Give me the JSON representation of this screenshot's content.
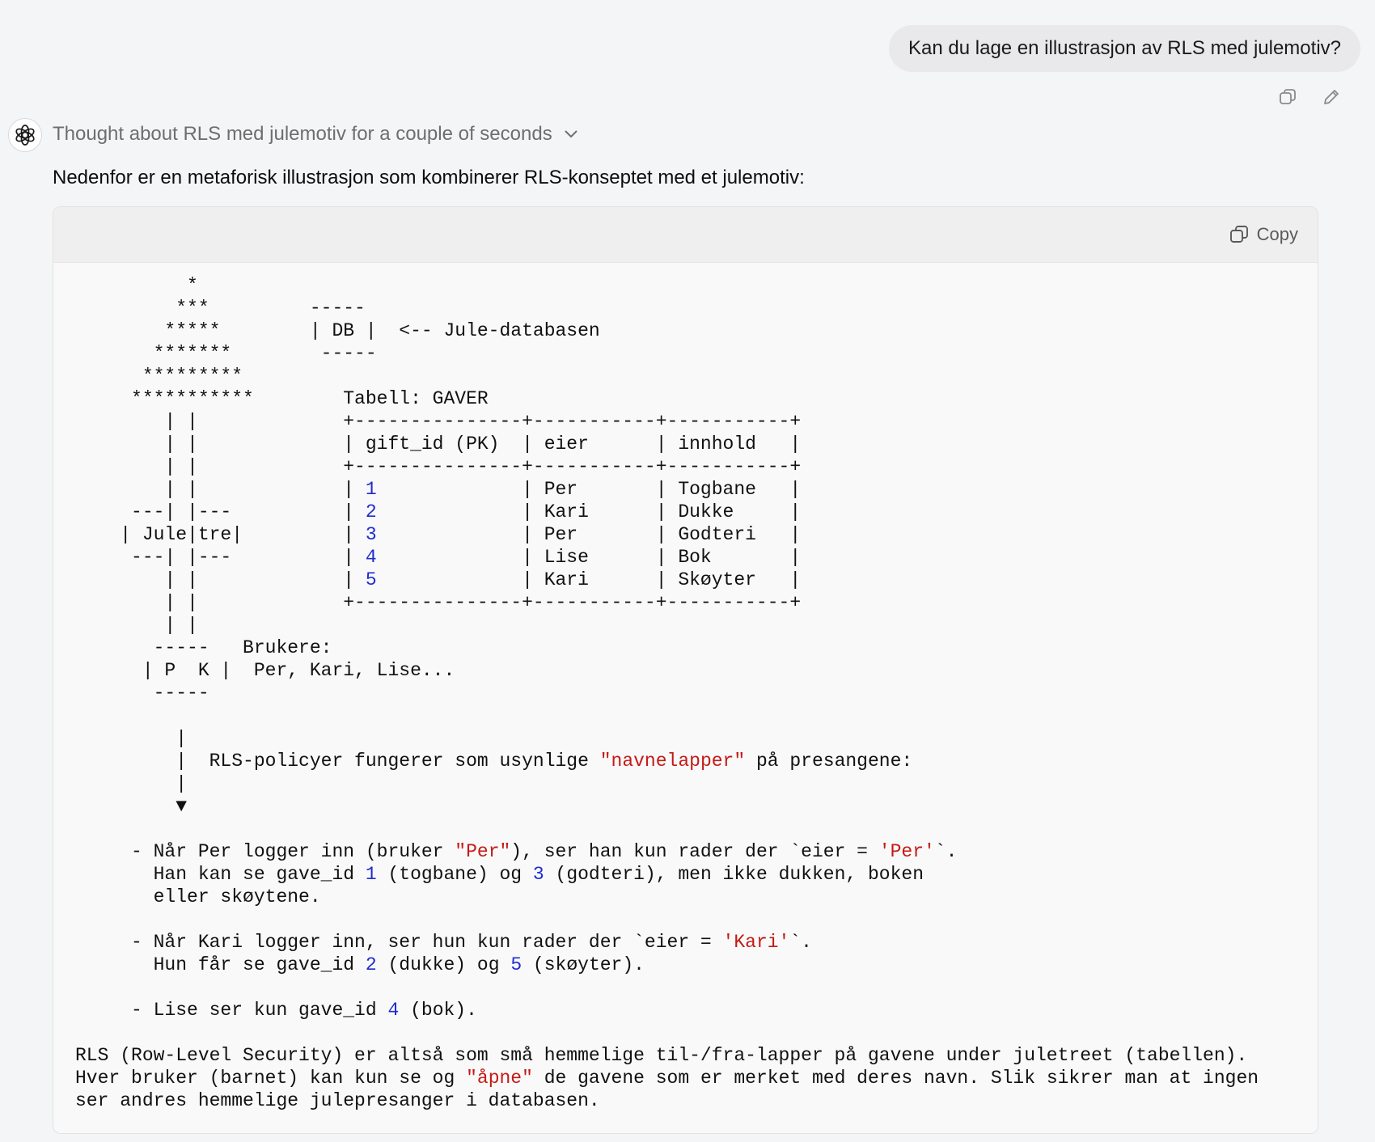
{
  "user_message": "Kan du lage en illustrasjon av RLS med julemotiv?",
  "user_actions": {
    "copy": "copy-icon",
    "edit": "pencil-icon"
  },
  "assistant": {
    "avatar": "openai-logo",
    "thought": "Thought about RLS med julemotiv for a couple of seconds",
    "intro": "Nedenfor er en metaforisk illustrasjon som kombinerer RLS-konseptet med et julemotiv:"
  },
  "code_block": {
    "copy_label": "Copy",
    "lines": [
      [
        {
          "t": "          *"
        }
      ],
      [
        {
          "t": "         ***         -----"
        }
      ],
      [
        {
          "t": "        *****        | DB |  <-- Jule-databasen"
        }
      ],
      [
        {
          "t": "       *******        -----"
        }
      ],
      [
        {
          "t": "      *********"
        }
      ],
      [
        {
          "t": "     ***********        Tabell: GAVER"
        }
      ],
      [
        {
          "t": "        | |             +---------------+-----------+-----------+"
        }
      ],
      [
        {
          "t": "        | |             | gift_id (PK)  | eier      | innhold   |"
        }
      ],
      [
        {
          "t": "        | |             +---------------+-----------+-----------+"
        }
      ],
      [
        {
          "t": "        | |             | "
        },
        {
          "t": "1",
          "c": "num"
        },
        {
          "t": "             | Per       | Togbane   |"
        }
      ],
      [
        {
          "t": "     ---| |---          | "
        },
        {
          "t": "2",
          "c": "num"
        },
        {
          "t": "             | Kari      | Dukke     |"
        }
      ],
      [
        {
          "t": "    | Jule|tre|         | "
        },
        {
          "t": "3",
          "c": "num"
        },
        {
          "t": "             | Per       | Godteri   |"
        }
      ],
      [
        {
          "t": "     ---| |---          | "
        },
        {
          "t": "4",
          "c": "num"
        },
        {
          "t": "             | Lise      | Bok       |"
        }
      ],
      [
        {
          "t": "        | |             | "
        },
        {
          "t": "5",
          "c": "num"
        },
        {
          "t": "             | Kari      | Skøyter   |"
        }
      ],
      [
        {
          "t": "        | |             +---------------+-----------+-----------+"
        }
      ],
      [
        {
          "t": "        | |"
        }
      ],
      [
        {
          "t": "       -----   Brukere:"
        }
      ],
      [
        {
          "t": "      | P  K |  Per, Kari, Lise..."
        }
      ],
      [
        {
          "t": "       -----"
        }
      ],
      [
        {
          "t": ""
        }
      ],
      [
        {
          "t": "         |"
        }
      ],
      [
        {
          "t": "         |  RLS-policyer fungerer som usynlige "
        },
        {
          "t": "\"navnelapper\"",
          "c": "str"
        },
        {
          "t": " på presangene:"
        }
      ],
      [
        {
          "t": "         |"
        }
      ],
      [
        {
          "t": "         ▼"
        }
      ],
      [
        {
          "t": ""
        }
      ],
      [
        {
          "t": "     - Når Per logger inn (bruker "
        },
        {
          "t": "\"Per\"",
          "c": "str"
        },
        {
          "t": "), ser han kun rader der `eier = "
        },
        {
          "t": "'Per'",
          "c": "str"
        },
        {
          "t": "`."
        }
      ],
      [
        {
          "t": "       Han kan se gave_id "
        },
        {
          "t": "1",
          "c": "num"
        },
        {
          "t": " (togbane) og "
        },
        {
          "t": "3",
          "c": "num"
        },
        {
          "t": " (godteri), men ikke dukken, boken"
        }
      ],
      [
        {
          "t": "       eller skøytene."
        }
      ],
      [
        {
          "t": ""
        }
      ],
      [
        {
          "t": "     - Når Kari logger inn, ser hun kun rader der `eier = "
        },
        {
          "t": "'Kari'",
          "c": "str"
        },
        {
          "t": "`."
        }
      ],
      [
        {
          "t": "       Hun får se gave_id "
        },
        {
          "t": "2",
          "c": "num"
        },
        {
          "t": " (dukke) og "
        },
        {
          "t": "5",
          "c": "num"
        },
        {
          "t": " (skøyter)."
        }
      ],
      [
        {
          "t": ""
        }
      ],
      [
        {
          "t": "     - Lise ser kun gave_id "
        },
        {
          "t": "4",
          "c": "num"
        },
        {
          "t": " (bok)."
        }
      ],
      [
        {
          "t": ""
        }
      ],
      [
        {
          "t": "RLS (Row-Level Security) er altså som små hemmelige til-/fra-lapper på gavene under juletreet (tabellen)."
        }
      ],
      [
        {
          "t": "Hver bruker (barnet) kan kun se og "
        },
        {
          "t": "\"åpne\"",
          "c": "str"
        },
        {
          "t": " de gavene som er merket med deres navn. Slik sikrer man at ingen"
        }
      ],
      [
        {
          "t": "ser andres hemmelige julepresanger i databasen."
        }
      ]
    ]
  }
}
